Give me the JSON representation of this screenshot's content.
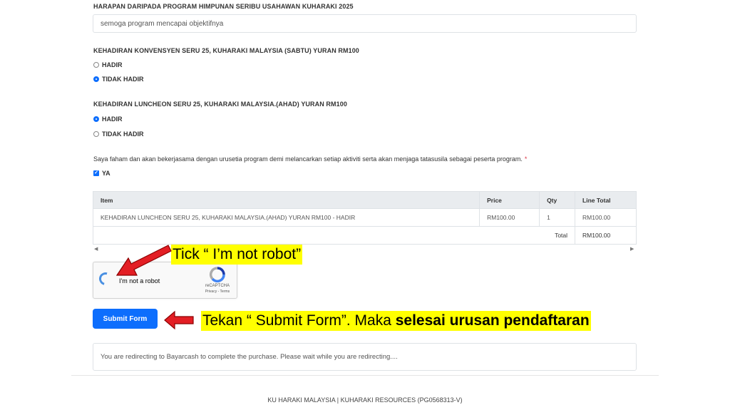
{
  "q1": {
    "label": "HARAPAN DARIPADA PROGRAM HIMPUNAN SERIBU USAHAWAN KUHARAKI 2025",
    "value": "semoga program mencapai objektifnya"
  },
  "q2": {
    "label": "KEHADIRAN KONVENSYEN SERU 25, KUHARAKI MALAYSIA (SABTU) YURAN RM100",
    "options": [
      "HADIR",
      "TIDAK HADIR"
    ],
    "selected": "TIDAK HADIR"
  },
  "q3": {
    "label": "KEHADIRAN LUNCHEON SERU 25, KUHARAKI MALAYSIA.(AHAD) YURAN RM100",
    "options": [
      "HADIR",
      "TIDAK HADIR"
    ],
    "selected": "HADIR"
  },
  "agreement": {
    "label": "Saya faham dan akan bekerjasama dengan urusetia program demi melancarkan setiap aktiviti serta akan menjaga tatasusila sebagai peserta program.",
    "required_mark": "*",
    "checkbox_label": "YA",
    "checked": true
  },
  "cart": {
    "headers": [
      "Item",
      "Price",
      "Qty",
      "Line Total"
    ],
    "rows": [
      [
        "KEHADIRAN LUNCHEON SERU 25, KUHARAKI MALAYSIA.(AHAD) YURAN RM100 - HADIR",
        "RM100.00",
        "1",
        "RM100.00"
      ]
    ],
    "total_label": "Total",
    "total_value": "RM100.00"
  },
  "captcha": {
    "label": "I'm not a robot",
    "brand": "reCAPTCHA",
    "links": "Privacy - Terms"
  },
  "submit": {
    "label": "Submit Form"
  },
  "redirect_message": "You are redirecting to Bayarcash to complete the purchase. Please wait while you are redirecting....",
  "annotations": {
    "tick_note": "Tick “ I’m not robot”",
    "submit_note_plain": "Tekan “ Submit Form”. Maka ",
    "submit_note_bold": "selesai urusan pendaftaran",
    "arrow_color": "#e31e24",
    "highlight_color": "#ffff00"
  },
  "footer": {
    "text": "KU HARAKI MALAYSIA | KUHARAKI RESOURCES (PG0568313-V)"
  },
  "colors": {
    "primary": "#0d6efd",
    "required": "#dc3545"
  }
}
